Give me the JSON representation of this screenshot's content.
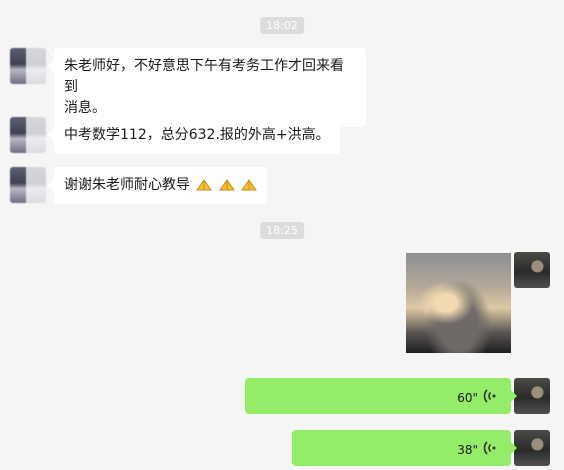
{
  "timestamps": [
    "18:02",
    "18:25"
  ],
  "messages_in": [
    {
      "lines": [
        "朱老师好，不好意思下午有考务工作才回来看到",
        "消息。"
      ]
    },
    {
      "lines": [
        "中考数学112，总分632.报的外高+洪高。"
      ]
    },
    {
      "text": "谢谢朱老师耐心教导",
      "emoji": "praying-hands-icon"
    }
  ],
  "messages_out": [
    {
      "type": "image"
    },
    {
      "type": "voice",
      "duration": "60\""
    },
    {
      "type": "voice",
      "duration": "38\""
    }
  ],
  "colors": {
    "background": "#f5f5f5",
    "incoming_bubble": "#ffffff",
    "outgoing_bubble": "#95ec69",
    "timestamp_chip": "#dcdcdc"
  }
}
